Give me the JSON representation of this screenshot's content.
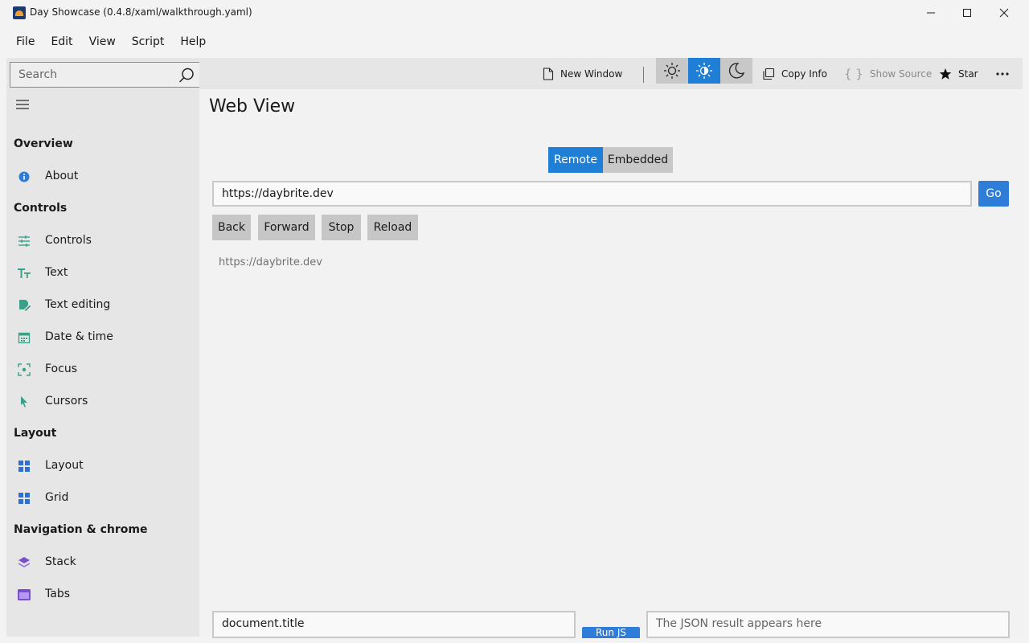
{
  "window": {
    "title": "Day Showcase (0.4.8/xaml/walkthrough.yaml)"
  },
  "menu": [
    "File",
    "Edit",
    "View",
    "Script",
    "Help"
  ],
  "search": {
    "placeholder": "Search"
  },
  "toolbar": {
    "new_window": "New Window",
    "copy_info": "Copy Info",
    "show_source": "Show Source",
    "star": "Star",
    "theme_active": "auto-theme",
    "accent": "#1f7fd6"
  },
  "sidebar": {
    "sections": [
      {
        "title": "Overview",
        "items": [
          {
            "label": "About",
            "icon": "info-icon"
          }
        ]
      },
      {
        "title": "Controls",
        "items": [
          {
            "label": "Controls",
            "icon": "sliders-icon"
          },
          {
            "label": "Text",
            "icon": "text-icon"
          },
          {
            "label": "Text editing",
            "icon": "edit-icon"
          },
          {
            "label": "Date & time",
            "icon": "calendar-icon"
          },
          {
            "label": "Focus",
            "icon": "focus-icon"
          },
          {
            "label": "Cursors",
            "icon": "cursor-icon"
          }
        ]
      },
      {
        "title": "Layout",
        "items": [
          {
            "label": "Layout",
            "icon": "layout-icon"
          },
          {
            "label": "Grid",
            "icon": "grid-icon"
          }
        ]
      },
      {
        "title": "Navigation & chrome",
        "items": [
          {
            "label": "Stack",
            "icon": "stack-icon"
          },
          {
            "label": "Tabs",
            "icon": "tabs-icon"
          }
        ]
      }
    ]
  },
  "main": {
    "title": "Web View",
    "mode_tabs": [
      "Remote",
      "Embedded"
    ],
    "selected_mode": "Remote",
    "url_value": "https://daybrite.dev",
    "go_label": "Go",
    "nav_buttons": [
      "Back",
      "Forward",
      "Stop",
      "Reload"
    ],
    "current_url": "https://daybrite.dev",
    "script_value": "document.title",
    "run_label": "Run JS",
    "result_placeholder": "The JSON result appears here"
  }
}
